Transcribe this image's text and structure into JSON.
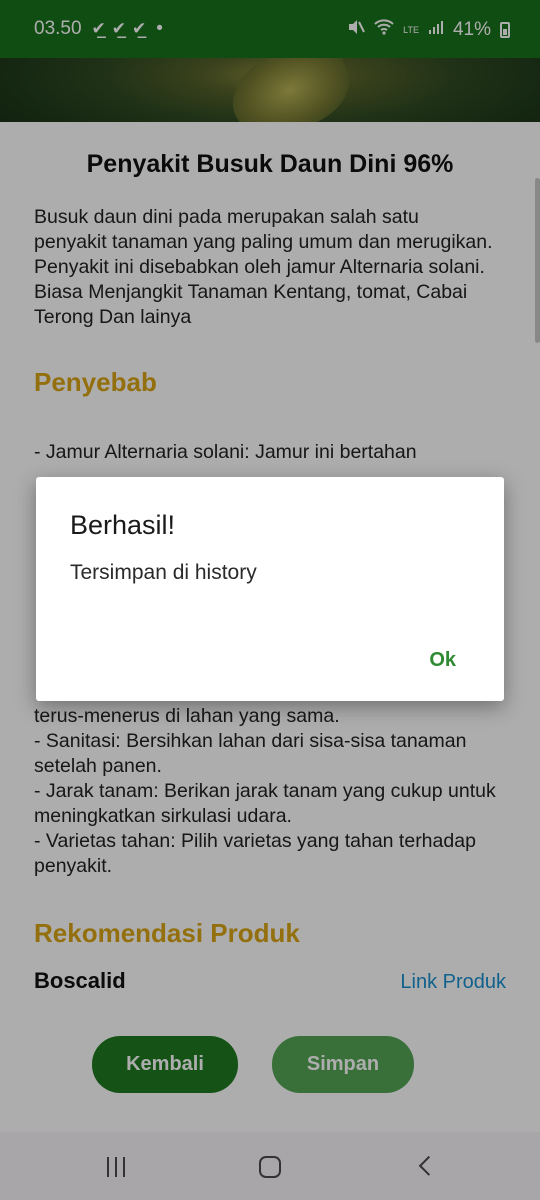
{
  "status_bar": {
    "time": "03.50",
    "notification_icons": [
      "download-done-icon",
      "download-done-icon",
      "download-done-icon"
    ],
    "dot": "•",
    "network_label": "LTE",
    "battery": "41%"
  },
  "article": {
    "title": "Penyakit Busuk Daun Dini 96%",
    "description": "Busuk daun dini pada merupakan salah satu penyakit tanaman yang paling umum dan merugikan. Penyakit ini disebabkan oleh jamur Alternaria solani. Biasa Menjangkit Tanaman Kentang, tomat, Cabai Terong Dan lainya",
    "cause_heading": "Penyebab",
    "cause_text": " - Jamur Alternaria solani: Jamur ini bertahan",
    "prevention_text_lines": [
      "terus-menerus di lahan yang sama.",
      " - Sanitasi: Bersihkan lahan dari sisa-sisa tanaman setelah panen.",
      " - Jarak tanam: Berikan jarak tanam yang cukup untuk meningkatkan sirkulasi udara.",
      " - Varietas tahan: Pilih varietas yang tahan terhadap penyakit."
    ],
    "recommendation_heading": "Rekomendasi Produk",
    "product_name": "Boscalid",
    "product_link": "Link Produk"
  },
  "buttons": {
    "back": "Kembali",
    "save": "Simpan"
  },
  "dialog": {
    "title": "Berhasil!",
    "message": "Tersimpan di history",
    "ok": "Ok"
  },
  "colors": {
    "status_bar": "#18721c",
    "heading": "#d9a514",
    "link": "#1a8fd0",
    "primary_button": "#1e7b20",
    "secondary_button": "#54a556",
    "dialog_ok": "#2e8b33"
  }
}
